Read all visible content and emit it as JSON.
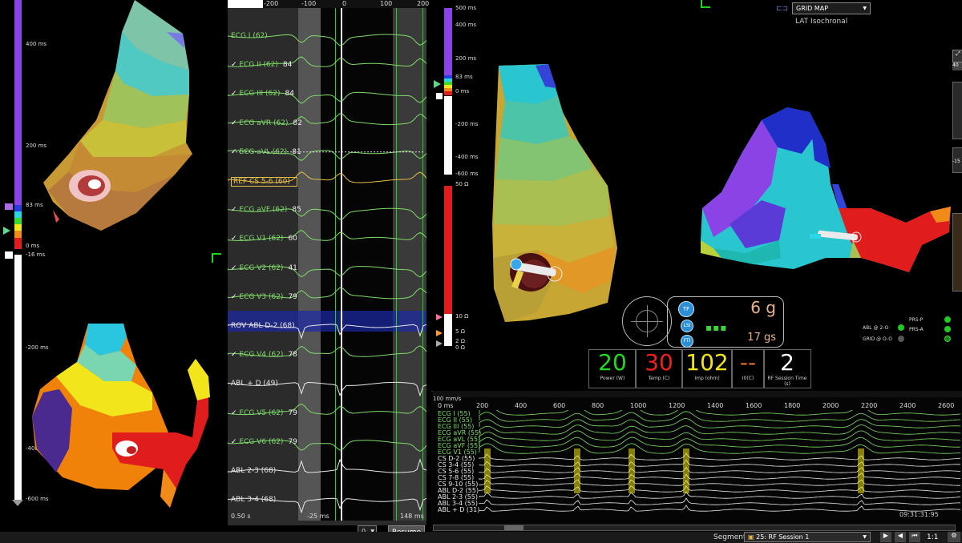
{
  "left_scale": {
    "ticks": [
      "400 ms",
      "200 ms",
      "83 ms",
      "0 ms",
      "-16 ms",
      "-200 ms",
      "-400 ms",
      "-600 ms"
    ]
  },
  "trace_panel": {
    "top_axis": [
      "-200",
      "-100",
      "0",
      "100",
      "200"
    ],
    "leads": [
      {
        "label": "ECG I (62)",
        "value": "",
        "color": "green",
        "checked": false
      },
      {
        "label": "ECG II (62)",
        "value": "84",
        "color": "green",
        "checked": true
      },
      {
        "label": "ECG III (62)",
        "value": "84",
        "color": "green",
        "checked": true
      },
      {
        "label": "ECG aVR (62)",
        "value": "82",
        "color": "green",
        "checked": true
      },
      {
        "label": "ECG aVL (62)",
        "value": "81",
        "color": "green",
        "checked": true
      },
      {
        "label": "REF CS  5-6 (60)",
        "value": "",
        "color": "yellow",
        "checked": false
      },
      {
        "label": "ECG aVF (62)",
        "value": "85",
        "color": "green",
        "checked": true
      },
      {
        "label": "ECG V1 (62)",
        "value": "60",
        "color": "green",
        "checked": true
      },
      {
        "label": "ECG V2 (62)",
        "value": "41",
        "color": "green",
        "checked": true
      },
      {
        "label": "ECG V3 (62)",
        "value": "79",
        "color": "green",
        "checked": true
      },
      {
        "label": "ROV ABL  D-2 (68)",
        "value": "",
        "color": "white",
        "checked": false
      },
      {
        "label": "ECG V4 (62)",
        "value": "78",
        "color": "green",
        "checked": true
      },
      {
        "label": "ABL + D (49)",
        "value": "",
        "color": "white",
        "checked": false
      },
      {
        "label": "ECG V5 (62)",
        "value": "79",
        "color": "green",
        "checked": true
      },
      {
        "label": "ECG V6 (62)",
        "value": "79",
        "color": "green",
        "checked": true
      },
      {
        "label": "ABL  2-3 (68)",
        "value": "",
        "color": "white",
        "checked": false
      },
      {
        "label": "ABL  3-4 (68)",
        "value": "",
        "color": "white",
        "checked": false
      }
    ],
    "bottom_left": "0.50 s",
    "bottom_mid": "-25 ms",
    "bottom_right": "148 ms",
    "dropdown_value": "0",
    "resume_label": "Resume"
  },
  "mid_scale": {
    "lat_ticks": [
      "500 ms",
      "400 ms",
      "200 ms",
      "83 ms",
      "0 ms",
      "-200 ms",
      "-400 ms",
      "-600 ms"
    ],
    "imp_ticks": [
      "50 Ω",
      "10 Ω",
      "5 Ω",
      "2 Ω",
      "0 Ω"
    ]
  },
  "header": {
    "map_select": "GRID MAP",
    "map_subtitle": "LAT Isochronal"
  },
  "catheter": {
    "force_value": "6 g",
    "force_integral": "17 gs",
    "badge_tf": "TF",
    "badge_lsi": "LSI",
    "badge_fti": "FTI"
  },
  "status": {
    "abl_label": "ABL @ 2-O",
    "grid_label": "GRID @ O-O",
    "prs_p": "PRS-P",
    "prs_a": "PRS-A"
  },
  "metrics": [
    {
      "value": "20",
      "label": "Power (W)",
      "color": "#22d822"
    },
    {
      "value": "30",
      "label": "Temp (C)",
      "color": "#ee2020"
    },
    {
      "value": "102",
      "label": "Imp (ohm)",
      "color": "#f2e51c"
    },
    {
      "value": "--",
      "label": "I0(C)",
      "color": "#e07020"
    },
    {
      "value": "2",
      "label": "RF Session Time (s)",
      "color": "#ffffff"
    }
  ],
  "lower_panel": {
    "speed": "100 mm/s",
    "axis": [
      "0 ms",
      "200",
      "400",
      "600",
      "800",
      "1000",
      "1200",
      "1400",
      "1600",
      "1800",
      "2000",
      "2200",
      "2400",
      "2600"
    ],
    "channels": [
      {
        "label": "ECG I (55)",
        "color": "green"
      },
      {
        "label": "ECG II (55)",
        "color": "green"
      },
      {
        "label": "ECG III (55)",
        "color": "green"
      },
      {
        "label": "ECG aVR (55)",
        "color": "green"
      },
      {
        "label": "ECG aVL (55)",
        "color": "green"
      },
      {
        "label": "ECG aVF (55)",
        "color": "green"
      },
      {
        "label": "ECG V1 (55)",
        "color": "green"
      },
      {
        "label": "CS  D-2 (55)",
        "color": "white"
      },
      {
        "label": "CS  3-4 (55)",
        "color": "white"
      },
      {
        "label": "CS  5-6 (55)",
        "color": "white"
      },
      {
        "label": "CS  7-8 (55)",
        "color": "white"
      },
      {
        "label": "CS  9-10 (55)",
        "color": "white"
      },
      {
        "label": "ABL  D-2 (55)",
        "color": "white"
      },
      {
        "label": "ABL  2-3 (55)",
        "color": "white"
      },
      {
        "label": "ABL  3-4 (55)",
        "color": "white"
      },
      {
        "label": "ABL + D (31)",
        "color": "white"
      }
    ],
    "clock": "09:31:31:95"
  },
  "footer": {
    "segment_label": "Segment",
    "segment_value": "25: RF Session 1",
    "ratio": "1:1"
  },
  "right_edge": {
    "top_value": "40",
    "mid_value": "-15"
  }
}
